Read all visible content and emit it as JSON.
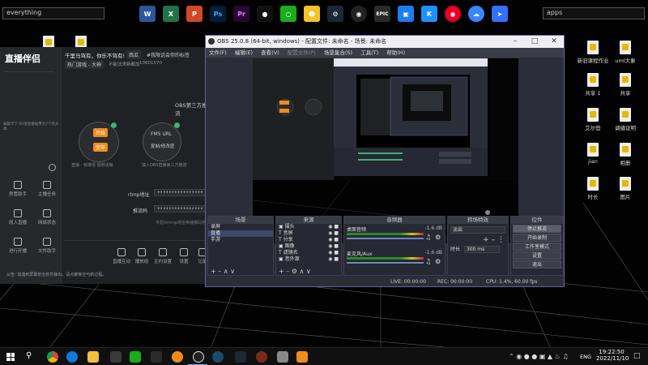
{
  "desktop": {
    "search_left": {
      "value": "everything"
    },
    "search_right": {
      "value": "apps"
    },
    "taskbar_icons": [
      "Word",
      "Excel",
      "PowerPoint",
      "Photoshop",
      "Premiere",
      "QQ",
      "WeChat",
      "QQ Pet",
      "Steam",
      "OBS",
      "Epic Games",
      "Remote",
      "K",
      "NetEase",
      "Baidu Pan",
      "Feishu"
    ],
    "icons": [
      {
        "label": "新旧课程作业"
      },
      {
        "label": "uml大象"
      },
      {
        "label": "共享 1"
      },
      {
        "label": "共享"
      },
      {
        "label": "艾尔登"
      },
      {
        "label": "调缝证明"
      },
      {
        "label": "jian"
      },
      {
        "label": "相册"
      },
      {
        "label": "时长"
      },
      {
        "label": "图片"
      },
      {
        "label": "控"
      }
    ],
    "taskbar": {
      "clock_time": "19:22:50",
      "clock_date": "2022/11/10",
      "lang": "ENG",
      "brand_color": "#0078d4"
    }
  },
  "stream_app": {
    "logo": "直播伴侣",
    "header_left": "千里马驾有，你乐不驾有!",
    "header_tag": "西瓜",
    "header_hint": "#我限话会你的标签",
    "sub_left": "热门游戏 - 大神",
    "sub_mid": "不能法来新都加",
    "sub_id": "10601570",
    "right_title": "OBS第三方推流",
    "fms_label": "FMS URL",
    "copy_label": "复制/修改密",
    "side_note": "编辑卡下 60倍直播级用为7个的文章",
    "rtmp_label": "rtmp地址",
    "stream_key_label": "推流码",
    "hint_text": "专题对rtmp地址等播推码地址",
    "bottom_tip": "公告: 如遇到屏幕安全软件弹出，请点聚焦全与新过程。",
    "side_buttons": [
      "房管助手",
      "主播任务",
      "原入直播",
      "网络状态",
      "进行开播",
      "文件助手"
    ],
    "bottom_tools": [
      "直播互动",
      "播放组",
      "主约设置",
      "设置",
      "记录"
    ],
    "btn_a": "开始",
    "btn_b": "完毕",
    "desc_a": "直播 - 标准清 视频清晰",
    "desc_b": "填入OBS直播第三方推流"
  },
  "obs": {
    "title": "OBS 25.0.8 (64-bit, windows) - 配置文件: 未命名 - 场景: 未命名",
    "menu": [
      "文件(F)",
      "编辑(E)",
      "查看(V)",
      "配置文件(P)",
      "场景集合(S)",
      "工具(T)",
      "帮助(H)"
    ],
    "scenes": {
      "header": "场景",
      "items": [
        "录屏",
        "直播",
        "手游"
      ]
    },
    "sources": {
      "header": "来源",
      "items": [
        "摄头",
        "音屏",
        "分享",
        "图像",
        "滤镜名",
        "音外源"
      ]
    },
    "mixer": {
      "header": "音频器",
      "ch1": "桌面音频",
      "ch1_db": "-1.6 dB",
      "ch2": "麦克风/Aux",
      "ch2_db": "-1.6 dB"
    },
    "transitions": {
      "header": "转场特效",
      "type": "淡出",
      "duration_label": "时长",
      "duration_value": "300 ms"
    },
    "controls": {
      "header": "控件",
      "buttons": [
        "停止推流",
        "开始录制",
        "工作室模式",
        "设置",
        "退出"
      ]
    },
    "status": {
      "live": "LIVE: 00:00:00",
      "rec": "REC: 00:00:00",
      "cpu": "CPU: 1.4%, 60.00 fps"
    }
  }
}
